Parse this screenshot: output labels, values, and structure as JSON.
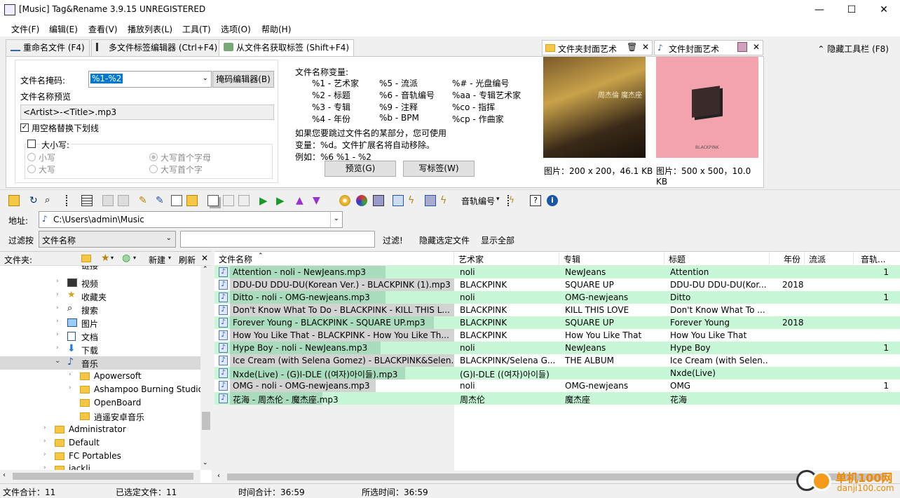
{
  "window": {
    "title": "[Music] Tag&Rename 3.9.15 UNREGISTERED",
    "min": "—",
    "max": "☐",
    "close": "✕"
  },
  "menu": [
    "文件(F)",
    "编辑(E)",
    "查看(V)",
    "播放列表(L)",
    "工具(T)",
    "选项(O)",
    "帮助(H)"
  ],
  "hide_toolbar": "⌃ 隐藏工具栏 (F8)",
  "tabs": [
    "重命名文件 (F4)",
    "多文件标签编辑器 (Ctrl+F4)",
    "从文件名获取标签 (Shift+F4)"
  ],
  "mask": {
    "label": "文件名掩码:",
    "value": "%1-%2",
    "editor_button": "掩码编辑器(B)",
    "preview_label": "文件名称预览",
    "preview_value": "<Artist>-<Title>.mp3",
    "replace_underscore": "用空格替换下划线",
    "case_label": "大小写:",
    "case_options": [
      "小写",
      "大写首个字母",
      "大写",
      "大写首个字"
    ]
  },
  "variables": {
    "title": "文件名称变量:",
    "items": [
      [
        "%1 - 艺术家",
        "%5 - 流派",
        "%# - 光盘编号"
      ],
      [
        "%2 - 标题",
        "%6 - 音轨编号",
        "%aa - 专辑艺术家"
      ],
      [
        "%3 - 专辑",
        "%9 - 注释",
        "%co - 指挥"
      ],
      [
        "%4 - 年份",
        "%b - BPM",
        "%cp - 作曲家"
      ]
    ],
    "note1": "如果您要跳过文件名的某部分，您可使用",
    "note2": "变量：%d。文件扩展名将自动移除。",
    "note3": "例如：%6 %1 - %2",
    "preview_button": "预览(G)",
    "write_button": "写标签(W)"
  },
  "covers": {
    "folder_tab": "文件夹封面艺术",
    "file_tab": "文件封面艺术",
    "folder_info": "图片：200 x 200，46.1 KB",
    "file_info": "图片：500 x 500，10.0 KB",
    "cover1_text": "周杰倫 魔杰座",
    "cover2_text": "BLACKPINK"
  },
  "toolbar": {
    "track_label": "音轨编号"
  },
  "address": {
    "label": "地址:",
    "path": "C:\\Users\\admin\\Music"
  },
  "filter": {
    "label": "过滤按",
    "field": "文件名称",
    "go": "过滤!",
    "hide": "隐藏选定文件",
    "show_all": "显示全部"
  },
  "tree": {
    "header": "文件夹:",
    "new": "新建",
    "refresh": "刷新",
    "items": [
      "链接",
      "视频",
      "收藏夹",
      "搜索",
      "图片",
      "文档",
      "下载",
      "音乐",
      "Apowersoft",
      "Ashampoo Burning Studio",
      "OpenBoard",
      "逍遥安卓音乐",
      "Administrator",
      "Default",
      "FC Portables",
      "jackli"
    ]
  },
  "columns": [
    "文件名称",
    "艺术家",
    "专辑",
    "标题",
    "年份",
    "流派",
    "音轨..."
  ],
  "files": [
    {
      "name": "Attention - noli - NewJeans.mp3",
      "artist": "noli",
      "album": "NewJeans",
      "title": "Attention",
      "year": "",
      "track": "1"
    },
    {
      "name": "DDU-DU DDU-DU(Korean Ver.) - BLACKPINK (1).mp3",
      "artist": "BLACKPINK",
      "album": "SQUARE UP",
      "title": "DDU-DU DDU-DU(Kor...",
      "year": "2018",
      "track": ""
    },
    {
      "name": "Ditto - noli - OMG-newjeans.mp3",
      "artist": "noli",
      "album": "OMG-newjeans",
      "title": "Ditto",
      "year": "",
      "track": "1"
    },
    {
      "name": "Don't Know What To Do - BLACKPINK - KILL THIS L...",
      "artist": "BLACKPINK",
      "album": "KILL THIS LOVE",
      "title": "Don't Know What To ...",
      "year": "",
      "track": ""
    },
    {
      "name": "Forever Young - BLACKPINK - SQUARE UP.mp3",
      "artist": "BLACKPINK",
      "album": "SQUARE UP",
      "title": "Forever Young",
      "year": "2018",
      "track": ""
    },
    {
      "name": "How You Like That - BLACKPINK - How You Like Th...",
      "artist": "BLACKPINK",
      "album": "How You Like That",
      "title": "How You Like That",
      "year": "",
      "track": ""
    },
    {
      "name": "Hype Boy - noli - NewJeans.mp3",
      "artist": "noli",
      "album": "NewJeans",
      "title": "Hype Boy",
      "year": "",
      "track": "1"
    },
    {
      "name": "Ice Cream (with Selena Gomez) - BLACKPINK&Selen...",
      "artist": "BLACKPINK/Selena G...",
      "album": "THE ALBUM",
      "title": "Ice Cream (with Selen...",
      "year": "",
      "track": ""
    },
    {
      "name": "Nxde(Live) - (G)I-DLE ((여자)아이들).mp3",
      "artist": "(G)I-DLE ((여자)아이들)",
      "album": "",
      "title": "Nxde(Live)",
      "year": "",
      "track": ""
    },
    {
      "name": "OMG - noli - OMG-newjeans.mp3",
      "artist": "noli",
      "album": "OMG-newjeans",
      "title": "OMG",
      "year": "",
      "track": "1"
    },
    {
      "name": "花海 - 周杰伦 - 魔杰座.mp3",
      "artist": "周杰伦",
      "album": "魔杰座",
      "title": "花海",
      "year": "",
      "track": ""
    }
  ],
  "status": {
    "total": "文件合计：11",
    "selected": "已选定文件：11",
    "time": "时间合计：36:59",
    "sel_time": "所选时间：36:59"
  },
  "watermark": {
    "line1": "单机100网",
    "line2": "danji100.com"
  }
}
